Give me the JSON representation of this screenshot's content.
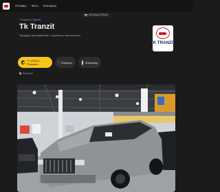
{
  "nav": {
    "links": [
      "Отзывы",
      "Фото",
      "Контакты"
    ]
  },
  "counter": {
    "text": "ПРОСМОТРЕНО"
  },
  "header": {
    "breadcrumb_prefix": "Т.Улица по",
    "breadcrumb_link": "Оделку",
    "title": "Tk Tranzit",
    "subtitle": "Продажа автомобилей с пробегом, Автосалоны"
  },
  "brand_logo": {
    "text": "TK TRANZIT"
  },
  "buttons": {
    "phone": "+7 (913) 0... Показать",
    "telegram": "Telegram",
    "whatsapp": "WhatsApp"
  },
  "location": {
    "text": "Барнаул"
  },
  "colors": {
    "background": "#1b1b1b",
    "accent_yellow": "#f5c51a",
    "button_dark": "#2e2e2e",
    "logo_red": "#c8202a",
    "logo_blue": "#1a2a6c"
  },
  "icons": [
    "phone-icon",
    "telegram-icon",
    "whatsapp-icon",
    "location-pin-icon"
  ]
}
